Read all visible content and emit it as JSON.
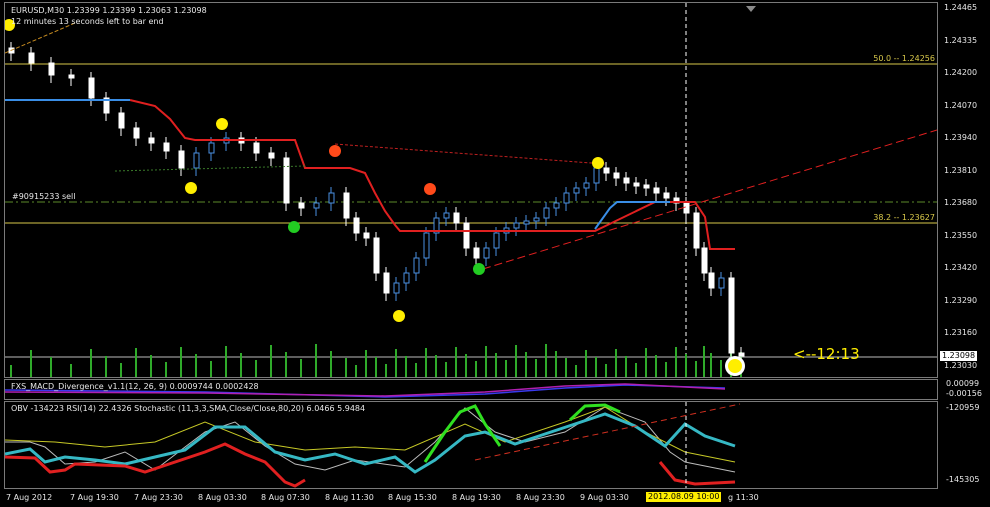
{
  "main": {
    "symbol_header": "EURUSD,M30  1.23399 1.23399 1.23063 1.23098",
    "timer_note": "12 minutes 13 seconds left to bar end",
    "order_label": "#90915233 sell",
    "fib_50": "50.0 -- 1.24256",
    "fib_382": "38.2 -- 1.23627",
    "countdown": "<--12:13",
    "current_price": "1.23098",
    "price_ticks": [
      "1.24465",
      "1.24335",
      "1.24200",
      "1.24070",
      "1.23940",
      "1.23810",
      "1.23680",
      "1.23550",
      "1.23420",
      "1.23290",
      "1.23160",
      "1.23030"
    ]
  },
  "macd": {
    "header": "FXS_MACD_Divergence_v1.1(12, 26, 9)  0.0009744  0.0002428",
    "ticks": [
      "0.00099",
      "-0.00156"
    ]
  },
  "osc": {
    "header": "OBV -134223  RSI(14) 22.4326  Stochastic (11,3,3,SMA,Close/Close,80,20) 6.0466 5.9484",
    "ticks": [
      "-120959",
      "-145305"
    ]
  },
  "time_axis": {
    "labels": [
      "7 Aug 2012",
      "7 Aug 19:30",
      "7 Aug 23:30",
      "8 Aug 03:30",
      "8 Aug 07:30",
      "8 Aug 11:30",
      "8 Aug 15:30",
      "8 Aug 19:30",
      "8 Aug 23:30",
      "9 Aug 03:30",
      "2012.08.09 10:00",
      "g 11:30"
    ]
  },
  "colors": {
    "up": "#4a90e2",
    "down": "#ffffff",
    "red_line": "#e02020",
    "blue_line": "#3a8ee6",
    "volume": "#2faa2a",
    "fib": "#d8c84a",
    "signal_yellow": "#ffee00",
    "signal_red": "#ff4a1a",
    "signal_green": "#22cc22"
  }
}
